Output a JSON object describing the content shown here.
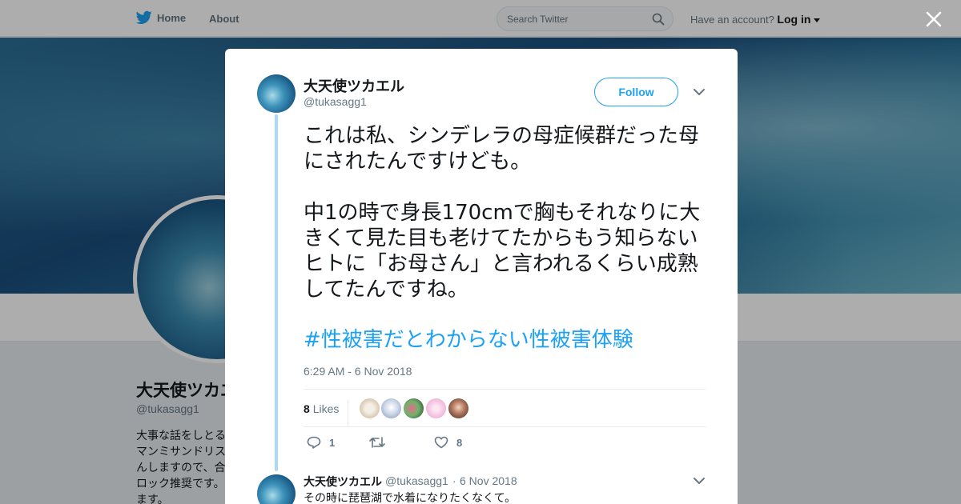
{
  "topbar": {
    "home_label": "Home",
    "about_label": "About",
    "search_placeholder": "Search Twitter",
    "account_prompt": "Have an account?",
    "login_label": "Log in"
  },
  "profile": {
    "name": "大天使ツカエル",
    "handle": "@tukasagg1",
    "bio": "大事な話をしとるマンミサンドリスんしますので、合ロック推奨です。ます。"
  },
  "tweet": {
    "author_name": "大天使ツカエル",
    "author_handle": "@tukasagg1",
    "follow_label": "Follow",
    "text": "これは私、シンデレラの母症候群だった母にされたんですけども。\n\n中1の時で身長170cmで胸もそれなりに大きくて見た目も老けてたからもう知らないヒトに「お母さん」と言われるくらい成熟してたんですね。",
    "hashtag": "#性被害だとわからない性被害体験",
    "timestamp": "6:29 AM - 6 Nov 2018",
    "likes_count": "8",
    "likes_label": "Likes",
    "reply_count": "1",
    "retweet_count": "",
    "like_count": "8"
  },
  "reply": {
    "author_name": "大天使ツカエル",
    "author_handle": "@tukasagg1",
    "separator": "·",
    "date": "6 Nov 2018",
    "text": "その時に琵琶湖で水着になりたくなくて。"
  },
  "colors": {
    "accent": "#1da1f2",
    "thread_line": "#aed9f6",
    "muted_text": "#657786"
  },
  "icons": [
    "twitter-bird-icon",
    "search-icon",
    "close-icon",
    "chevron-down-icon",
    "reply-icon",
    "retweet-icon",
    "heart-icon"
  ]
}
